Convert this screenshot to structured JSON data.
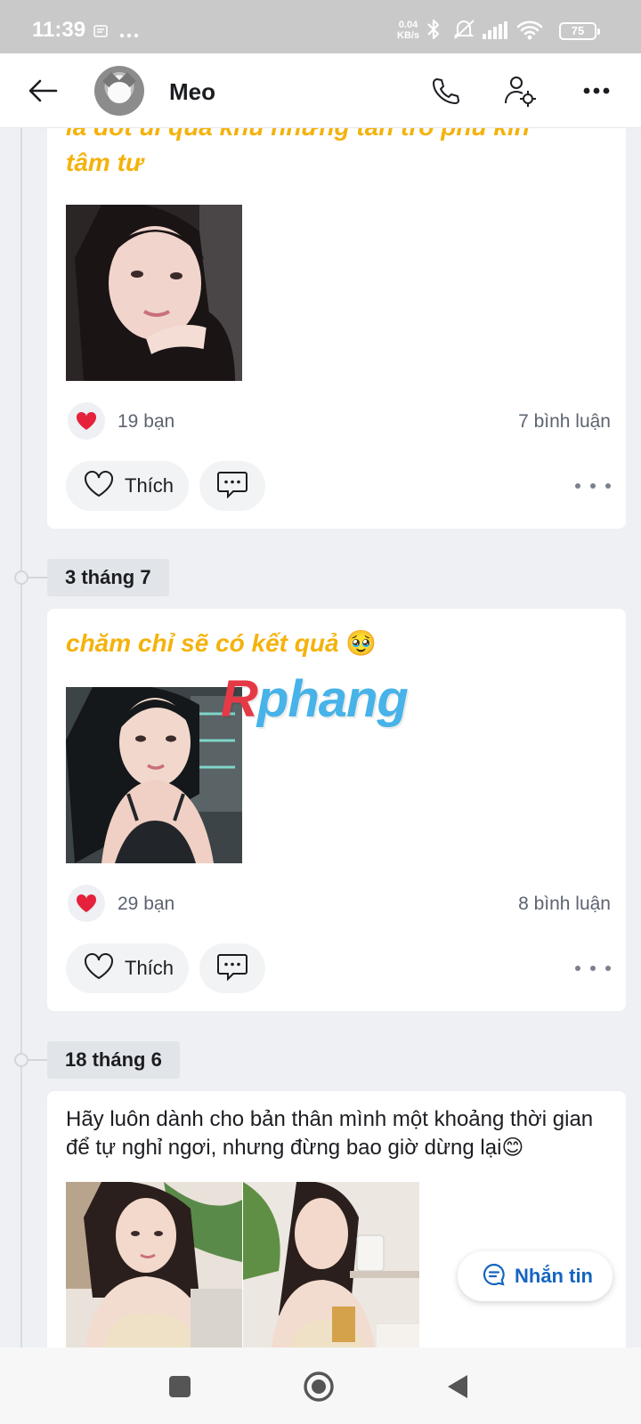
{
  "status_bar": {
    "time": "11:39",
    "speed_value": "0.04",
    "speed_unit": "KB/s",
    "battery": "75",
    "icons": [
      "notification-icon",
      "more-dots-icon",
      "bluetooth-icon",
      "mute-icon",
      "signal-icon",
      "wifi-icon",
      "battery-icon"
    ]
  },
  "header": {
    "title": "Meo",
    "icons": [
      "back-arrow-icon",
      "phone-icon",
      "user-settings-icon",
      "more-icon"
    ]
  },
  "timeline": [
    {
      "caption_line1": "là đốt ui qua khu nhưng tàn tro phủ kín",
      "caption_line2": "tâm tư",
      "reactions": "19 bạn",
      "comments": "7 bình luận",
      "like_label": "Thích"
    },
    {
      "date": "3 tháng 7",
      "caption": "chăm chỉ sẽ có kết quả",
      "caption_emoji": "🥹",
      "reactions": "29 bạn",
      "comments": "8 bình luận",
      "like_label": "Thích"
    },
    {
      "date": "18 tháng 6",
      "caption": "Hãy luôn dành cho bản thân mình một khoảng thời gian để tự nghỉ ngơi, nhưng đừng bao giờ dừng lại😊"
    }
  ],
  "watermark": {
    "part1": "R",
    "part2": "phang"
  },
  "message_button": {
    "label": "Nhắn tin"
  },
  "colors": {
    "caption_yellow": "#f4b20c",
    "link_blue": "#1565c0",
    "heart_red": "#e5213c"
  }
}
